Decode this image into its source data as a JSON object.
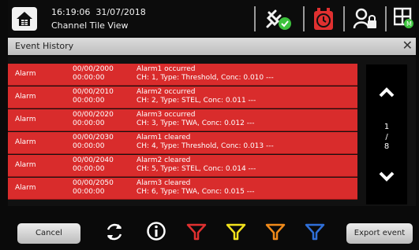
{
  "header": {
    "time": "16:19:06",
    "date": "31/07/2018",
    "view_name": "Channel Tile View"
  },
  "title_bar": {
    "title": "Event History",
    "close_glyph": "✕"
  },
  "events": [
    {
      "type": "Alarm",
      "date": "00/00/2000",
      "time": "00:00:00",
      "title": "Alarm1 occurred",
      "detail": "CH: 1, Type: Threshold, Conc: 0.010 ---"
    },
    {
      "type": "Alarm",
      "date": "00/00/2010",
      "time": "00:00:00",
      "title": "Alarm2 occurred",
      "detail": "CH: 2, Type: STEL, Conc: 0.011 ---"
    },
    {
      "type": "Alarm",
      "date": "00/00/2020",
      "time": "00:00:00",
      "title": "Alarm3 occurred",
      "detail": "CH: 3, Type: TWA, Conc: 0.012 ---"
    },
    {
      "type": "Alarm",
      "date": "00/00/2030",
      "time": "00:00:00",
      "title": "Alarm1 cleared",
      "detail": "CH: 4, Type: Threshold, Conc: 0.013 ---"
    },
    {
      "type": "Alarm",
      "date": "00/00/2040",
      "time": "00:00:00",
      "title": "Alarm2 cleared",
      "detail": "CH: 5, Type: STEL, Conc: 0.014 ---"
    },
    {
      "type": "Alarm",
      "date": "00/00/2050",
      "time": "00:00:00",
      "title": "Alarm3 cleared",
      "detail": "CH: 6, Type: TWA, Conc: 0.015 ---"
    }
  ],
  "pagination": {
    "current": "1",
    "separator": "/",
    "total": "8"
  },
  "toolbar": {
    "cancel_label": "Cancel",
    "export_label": "Export event",
    "filter_colors": [
      "#e03030",
      "#f2e21c",
      "#f08a1a",
      "#2f6fd8"
    ]
  },
  "colors": {
    "alarm_row": "#d92c2c",
    "status_green": "#3cc23c",
    "clock_red": "#e03030"
  },
  "icons": [
    "home-icon",
    "power-plug-icon",
    "check-badge-icon",
    "alarm-clock-icon",
    "user-lock-icon",
    "grid-menu-icon",
    "refresh-icon",
    "info-icon",
    "filter-icon",
    "chevron-up-icon",
    "chevron-down-icon"
  ]
}
